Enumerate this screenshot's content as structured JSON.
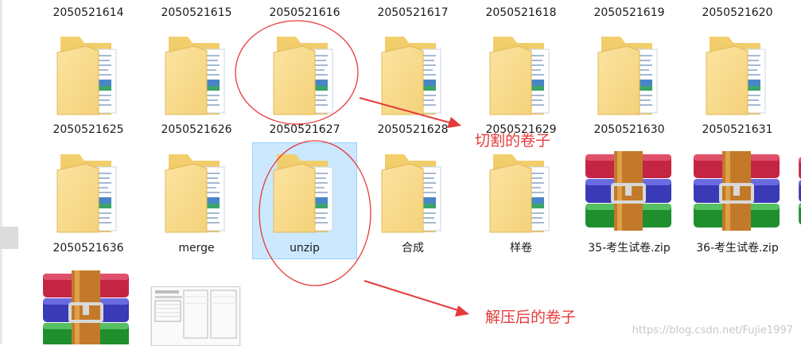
{
  "top_row_labels": [
    "2050521614",
    "2050521615",
    "2050521616",
    "2050521617",
    "2050521618",
    "2050521619",
    "2050521620"
  ],
  "row1_labels": [
    "2050521625",
    "2050521626",
    "2050521627",
    "2050521628",
    "2050521629",
    "2050521630",
    "2050521631"
  ],
  "row2": [
    {
      "label": "2050521636",
      "type": "folder"
    },
    {
      "label": "merge",
      "type": "folder"
    },
    {
      "label": "unzip",
      "type": "folder",
      "selected": true
    },
    {
      "label": "合成",
      "type": "folder"
    },
    {
      "label": "样卷",
      "type": "folder"
    },
    {
      "label": "35-考生试卷.zip",
      "type": "archive"
    },
    {
      "label": "36-考生试卷.zip",
      "type": "archive"
    }
  ],
  "row3": [
    {
      "type": "archive"
    },
    {
      "type": "document-thumbnail"
    }
  ],
  "annotations": {
    "cut_label": "切割的卷子",
    "unzip_label": "解压后的卷子",
    "color": "#e63a3a"
  },
  "watermark": "https://blog.csdn.net/Fujie1997",
  "colors": {
    "selection_bg": "#cce8ff",
    "selection_border": "#99d1ff",
    "folder": "#f5d47c"
  }
}
